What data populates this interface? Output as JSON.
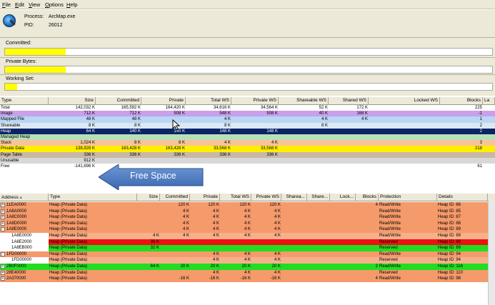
{
  "menu": [
    "File",
    "Edit",
    "View",
    "Options",
    "Help"
  ],
  "process": {
    "process_label": "Process:",
    "process_value": "ArcMap.exe",
    "pid_label": "PID:",
    "pid_value": "26012"
  },
  "meters": [
    {
      "label": "Committed:",
      "fill": 0.125
    },
    {
      "label": "Private Bytes:",
      "fill": 0.125
    },
    {
      "label": "Working Set:",
      "fill": 0.025
    }
  ],
  "summary": {
    "columns": [
      "Type",
      "Size",
      "Committed",
      "Private",
      "Total WS",
      "Private WS",
      "Shareable WS",
      "Shared WS",
      "Locked WS",
      "Blocks",
      "La"
    ],
    "rows": [
      {
        "type": "Total",
        "size": "142,032 K",
        "committed": "165,592 K",
        "private": "164,420 K",
        "total_ws": "34,616 K",
        "private_ws": "34,564 K",
        "shareable_ws": "52 K",
        "shared_ws": "172 K",
        "locked_ws": "",
        "blocks": "225",
        "bg": "#ffffff",
        "fg": "#000000"
      },
      {
        "type": "Image",
        "size": "712 K",
        "committed": "712 K",
        "private": "508 K",
        "total_ws": "548 K",
        "private_ws": "508 K",
        "shareable_ws": "40 K",
        "shared_ws": "168 K",
        "locked_ws": "",
        "blocks": "-1",
        "bg": "#c9a0ec",
        "fg": "#000000"
      },
      {
        "type": "Mapped File",
        "size": "48 K",
        "committed": "48 K",
        "private": "",
        "total_ws": "4 K",
        "private_ws": "",
        "shareable_ws": "4 K",
        "shared_ws": "4 K",
        "locked_ws": "",
        "blocks": "1",
        "bg": "#b9d6f4",
        "fg": "#000000"
      },
      {
        "type": "Shareable",
        "size": "8 K",
        "committed": "8 K",
        "private": "",
        "total_ws": "8 K",
        "private_ws": "",
        "shareable_ws": "8 K",
        "shared_ws": "",
        "locked_ws": "",
        "blocks": "2",
        "bg": "#dce8f4",
        "fg": "#000000"
      },
      {
        "type": "Heap",
        "size": "64 K",
        "committed": "140 K",
        "private": "140 K",
        "total_ws": "148 K",
        "private_ws": "148 K",
        "shareable_ws": "",
        "shared_ws": "",
        "locked_ws": "",
        "blocks": "2",
        "bg": "#0a2466",
        "fg": "#ffffff"
      },
      {
        "type": "Managed Heap",
        "size": "",
        "committed": "",
        "private": "",
        "total_ws": "",
        "private_ws": "",
        "shareable_ws": "",
        "shared_ws": "",
        "locked_ws": "",
        "blocks": "",
        "bg": "#b8e0b8",
        "fg": "#000000"
      },
      {
        "type": "Stack",
        "size": "1,024 K",
        "committed": "8 K",
        "private": "8 K",
        "total_ws": "4 K",
        "private_ws": "4 K",
        "shareable_ws": "",
        "shared_ws": "",
        "locked_ws": "",
        "blocks": "3",
        "bg": "#f8c39a",
        "fg": "#000000"
      },
      {
        "type": "Private Data",
        "size": "138,928 K",
        "committed": "163,428 K",
        "private": "163,428 K",
        "total_ws": "33,568 K",
        "private_ws": "33,568 K",
        "shareable_ws": "",
        "shared_ws": "",
        "locked_ws": "",
        "blocks": "218",
        "bg": "#ffee00",
        "fg": "#000000"
      },
      {
        "type": "Page Table",
        "size": "336 K",
        "committed": "336 K",
        "private": "336 K",
        "total_ws": "336 K",
        "private_ws": "336 K",
        "shareable_ws": "",
        "shared_ws": "",
        "locked_ws": "",
        "blocks": "",
        "bg": "#c8b8a8",
        "fg": "#000000"
      },
      {
        "type": "Unusable",
        "size": "912 K",
        "committed": "",
        "private": "",
        "total_ws": "",
        "private_ws": "",
        "shareable_ws": "",
        "shared_ws": "",
        "locked_ws": "",
        "blocks": "",
        "bg": "#d8d8d8",
        "fg": "#000000"
      },
      {
        "type": "Free",
        "size": "-141,696 K",
        "committed": "",
        "private": "",
        "total_ws": "",
        "private_ws": "",
        "shareable_ws": "",
        "shared_ws": "",
        "locked_ws": "",
        "blocks": "61",
        "bg": "#ffffff",
        "fg": "#000000"
      }
    ]
  },
  "callout": {
    "text": "Free Space"
  },
  "detail": {
    "columns": [
      "Address",
      "Type",
      "Size",
      "Committed",
      "Private",
      "Total WS",
      "Private WS",
      "Sharea...",
      "Share...",
      "Lock...",
      "Blocks",
      "Protection",
      "Details"
    ],
    "rows": [
      {
        "exp": "+",
        "address": "11EA0000",
        "type": "Heap (Private Data)",
        "size": "",
        "committed": "120 K",
        "private": "120 K",
        "total_ws": "120 K",
        "private_ws": "120 K",
        "blocks": "4",
        "protection": "Read/Write",
        "details": "Heap ID: 66",
        "bg": "#f59a6b",
        "indent": 0
      },
      {
        "exp": "+",
        "address": "1A8A0000",
        "type": "Heap (Private Data)",
        "size": "",
        "committed": "4 K",
        "private": "4 K",
        "total_ws": "4 K",
        "private_ws": "4 K",
        "blocks": "",
        "protection": "Read/Write",
        "details": "Heap ID: 85",
        "bg": "#f59a6b",
        "indent": 0
      },
      {
        "exp": "+",
        "address": "1A8C0000",
        "type": "Heap (Private Data)",
        "size": "",
        "committed": "4 K",
        "private": "4 K",
        "total_ws": "4 K",
        "private_ws": "4 K",
        "blocks": "",
        "protection": "Read/Write",
        "details": "Heap ID: 87",
        "bg": "#f59a6b",
        "indent": 0
      },
      {
        "exp": "+",
        "address": "1A8D0000",
        "type": "Heap (Private Data)",
        "size": "",
        "committed": "4 K",
        "private": "4 K",
        "total_ws": "4 K",
        "private_ws": "4 K",
        "blocks": "",
        "protection": "Read/Write",
        "details": "Heap ID: 88",
        "bg": "#f59a6b",
        "indent": 0
      },
      {
        "exp": "-",
        "address": "1A8E0000",
        "type": "Heap (Private Data)",
        "size": "",
        "committed": "4 K",
        "private": "4 K",
        "total_ws": "4 K",
        "private_ws": "4 K",
        "blocks": "",
        "protection": "Read/Write",
        "details": "Heap ID: 89",
        "bg": "#f59a6b",
        "indent": 0
      },
      {
        "exp": "",
        "address": "1A8E0000",
        "type": "Heap (Private Data)",
        "size": "4 K",
        "committed": "4 K",
        "private": "4 K",
        "total_ws": "4 K",
        "private_ws": "4 K",
        "blocks": "",
        "protection": "Read/Write",
        "details": "Heap ID: 89",
        "bg": "#f7b08a",
        "indent": 1
      },
      {
        "exp": "",
        "address": "1A8E2000",
        "type": "Heap (Private Data)",
        "size": "36 K",
        "committed": "",
        "private": "",
        "total_ws": "",
        "private_ws": "",
        "blocks": "",
        "protection": "Reserved",
        "details": "Heap ID: 89",
        "bg": "#ee1111",
        "indent": 1
      },
      {
        "exp": "",
        "address": "1A8EB000",
        "type": "Heap (Private Data)",
        "size": "32 K",
        "committed": "",
        "private": "",
        "total_ws": "",
        "private_ws": "",
        "blocks": "",
        "protection": "Reserved",
        "details": "Heap ID: 89",
        "bg": "#22dd22",
        "indent": 1
      },
      {
        "exp": "-",
        "address": "1FD00000",
        "type": "Heap (Private Data)",
        "size": "",
        "committed": "",
        "private": "4 K",
        "total_ws": "4 K",
        "private_ws": "4 K",
        "blocks": "",
        "protection": "Read/Write",
        "details": "Heap ID: 94",
        "bg": "#f59a6b",
        "indent": 0
      },
      {
        "exp": "",
        "address": "1FD00000",
        "type": "Heap (Private Data)",
        "size": "",
        "committed": "",
        "private": "4 K",
        "total_ws": "4 K",
        "private_ws": "4 K",
        "blocks": "",
        "protection": "Reserved",
        "details": "Heap ID: 94",
        "bg": "#f7b08a",
        "indent": 1
      },
      {
        "exp": "+",
        "address": "2B0F0000",
        "type": "Heap (Private Data)",
        "size": "64 K",
        "committed": "20 K",
        "private": "20 K",
        "total_ws": "20 K",
        "private_ws": "20 K",
        "blocks": "2",
        "protection": "Read/Write",
        "details": "Heap ID: 116",
        "bg": "#22dd22",
        "indent": 0
      },
      {
        "exp": "+",
        "address": "28E40000",
        "type": "Heap (Private Data)",
        "size": "",
        "committed": "",
        "private": "4 K",
        "total_ws": "4 K",
        "private_ws": "4 K",
        "blocks": "",
        "protection": "Reserved",
        "details": "Heap ID: 110",
        "bg": "#f59a6b",
        "indent": 0
      },
      {
        "exp": "+",
        "address": "2A370000",
        "type": "Heap (Private Data)",
        "size": "",
        "committed": "-16 K",
        "private": "-16 K",
        "total_ws": "-16 K",
        "private_ws": "-16 K",
        "blocks": "4",
        "protection": "Read/Write",
        "details": "Heap ID: 98",
        "bg": "#f59a6b",
        "indent": 0
      }
    ]
  }
}
